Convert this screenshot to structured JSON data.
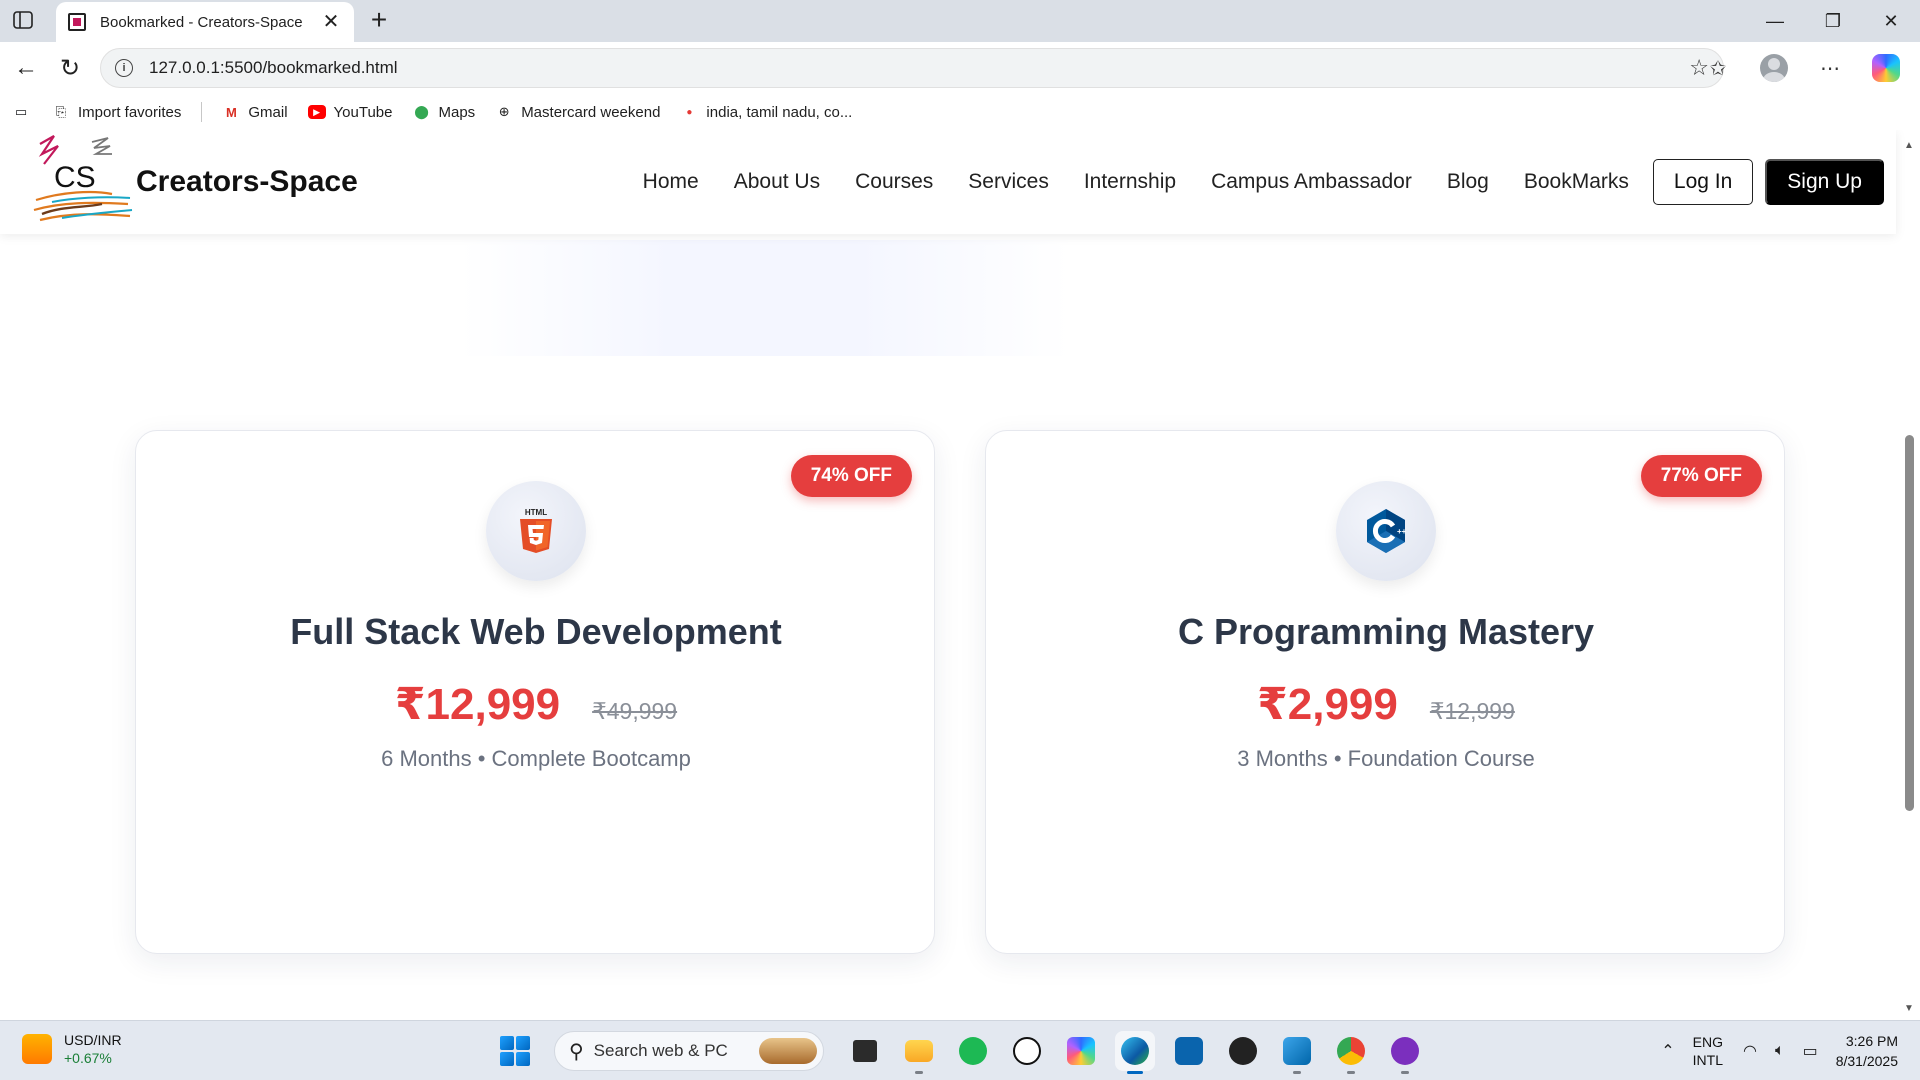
{
  "browser": {
    "tab_title": "Bookmarked - Creators-Space",
    "url": "127.0.0.1:5500/bookmarked.html",
    "bookmarks": [
      "Import favorites",
      "Gmail",
      "YouTube",
      "Maps",
      "Mastercard weekend",
      "india, tamil nadu, co..."
    ]
  },
  "site": {
    "logo_initials": "CS",
    "logo_text": "Creators-Space",
    "nav": [
      "Home",
      "About Us",
      "Courses",
      "Services",
      "Internship",
      "Campus Ambassador",
      "Blog",
      "BookMarks"
    ],
    "login_label": "Log In",
    "signup_label": "Sign Up"
  },
  "courses": [
    {
      "badge": "74% OFF",
      "icon": "html5-icon",
      "title": "Full Stack Web Development",
      "price": "₹12,999",
      "old_price": "₹49,999",
      "meta": "6 Months • Complete Bootcamp"
    },
    {
      "badge": "77% OFF",
      "icon": "cplusplus-icon",
      "title": "C Programming Mastery",
      "price": "₹2,999",
      "old_price": "₹12,999",
      "meta": "3 Months • Foundation Course"
    }
  ],
  "taskbar": {
    "widget_title": "USD/INR",
    "widget_change": "+0.67%",
    "search_placeholder": "Search web & PC",
    "lang_top": "ENG",
    "lang_bottom": "INTL",
    "time": "3:26 PM",
    "date": "8/31/2025"
  },
  "colors": {
    "accent_red": "#e53e3e",
    "title_dark": "#2d3748",
    "meta_gray": "#6b7280"
  }
}
